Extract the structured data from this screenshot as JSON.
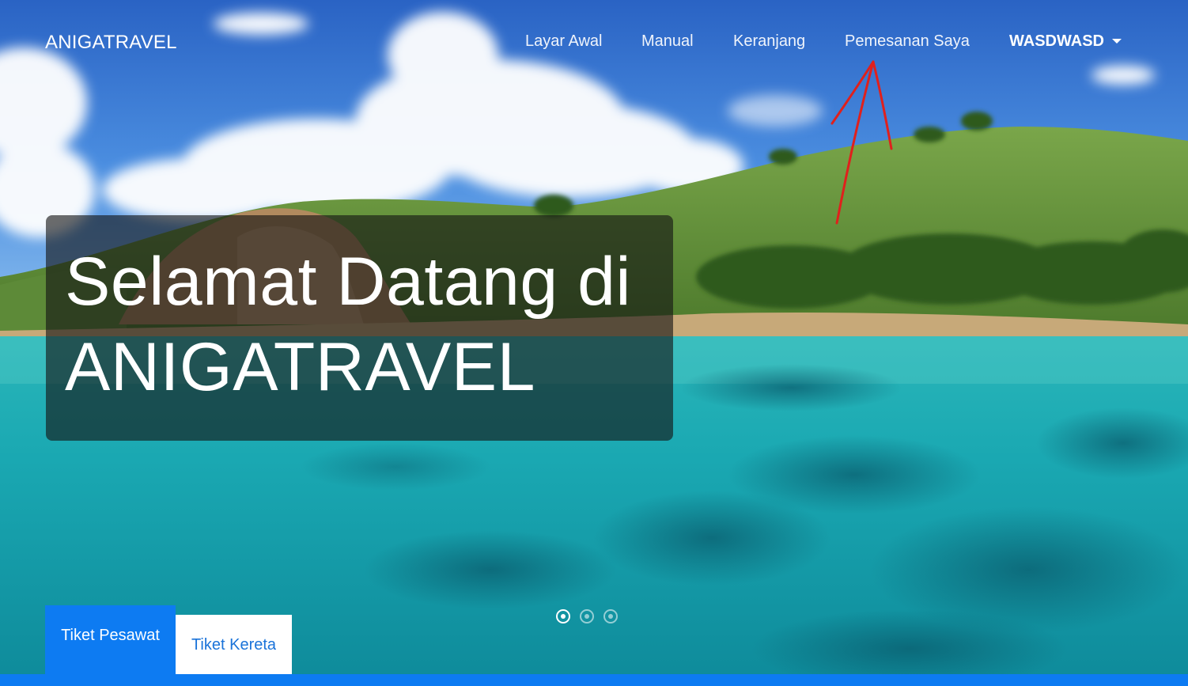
{
  "navbar": {
    "brand": "ANIGATRAVEL",
    "links": [
      {
        "label": "Layar Awal"
      },
      {
        "label": "Manual"
      },
      {
        "label": "Keranjang"
      },
      {
        "label": "Pemesanan Saya"
      }
    ],
    "user": {
      "label": "WASDWASD",
      "icon": "caret-down-icon"
    }
  },
  "hero": {
    "welcome_line1": "Selamat Datang di",
    "welcome_line2": "ANIGATRAVEL"
  },
  "carousel": {
    "slide_count": 3,
    "active_index": 0
  },
  "tickets": {
    "tabs": [
      {
        "label": "Tiket Pesawat",
        "active": true
      },
      {
        "label": "Tiket Kereta",
        "active": false
      }
    ]
  },
  "colors": {
    "accent": "#0d7bf2",
    "annotation": "#e0201c"
  }
}
